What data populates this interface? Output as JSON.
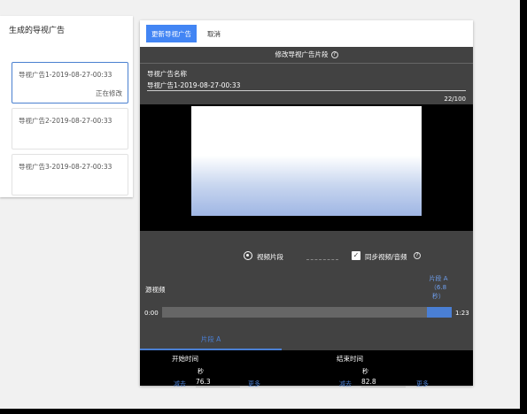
{
  "sidebar": {
    "title": "生成的导视广告",
    "items": [
      {
        "title": "导视广告1-2019-08-27-00:33",
        "status": "正在修改"
      },
      {
        "title": "导视广告2-2019-08-27-00:33"
      },
      {
        "title": "导视广告3-2019-08-27-00:33"
      }
    ]
  },
  "toolbar": {
    "update_label": "更新导视广告",
    "cancel_label": "取消"
  },
  "editor": {
    "header": "修改导视广告片段",
    "name_label": "导视广告名称",
    "name_value": "导视广告1-2019-08-27-00:33",
    "name_counter": "22/100",
    "source_options": {
      "clip": "视频片段",
      "sync_audio": "同步视频/音频"
    },
    "source_label": "源视频",
    "clip_tag": "片段 A（6.8 秒）",
    "timeline": {
      "start": "0:00",
      "end": "1:23",
      "selection_start_sec": 76.3,
      "selection_end_sec": 82.8
    },
    "tab_label": "片段 A",
    "start_time": {
      "label": "开始时间",
      "unit": "秒",
      "decrease": "减去",
      "value": "76.3",
      "more": "更多"
    },
    "end_time": {
      "label": "结束时间",
      "unit": "秒",
      "decrease": "减去",
      "value": "82.8",
      "more": "更多"
    }
  },
  "colors": {
    "accent": "#4285f4",
    "dark_panel": "#424242",
    "timeline_fill": "#4a7fd4"
  }
}
